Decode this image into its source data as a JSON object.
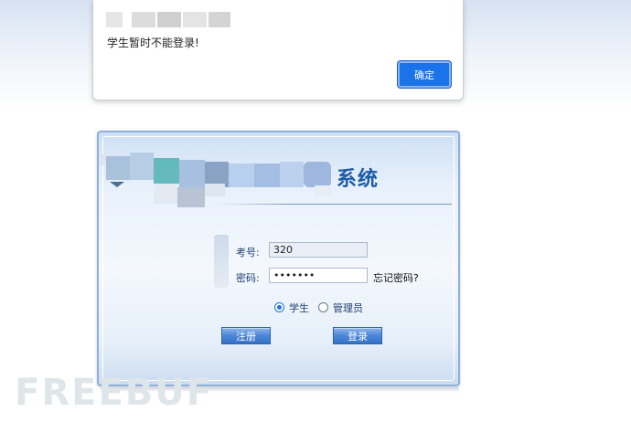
{
  "alert": {
    "message": "学生暂时不能登录!",
    "ok_label": "确定"
  },
  "login": {
    "system_title": "系统",
    "exam_label": "考号:",
    "exam_value": "320",
    "password_label": "密码:",
    "password_value": "•••••••",
    "forgot_label": "忘记密码?",
    "roles": [
      {
        "label": "学生",
        "checked": true
      },
      {
        "label": "管理员",
        "checked": false
      }
    ],
    "register_label": "注册",
    "login_label": "登录"
  },
  "watermark": "FREEBUF",
  "colors": {
    "accent": "#1a73e8",
    "title": "#1d5aa8",
    "label": "#1e3f73"
  }
}
